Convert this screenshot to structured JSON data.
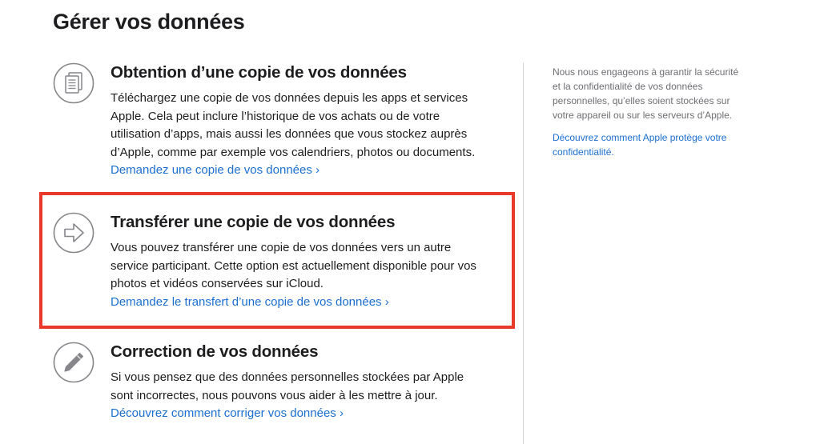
{
  "page": {
    "title": "Gérer vos données"
  },
  "sections": [
    {
      "title": "Obtention d’une copie de vos données",
      "body_lines": [
        "Téléchargez une copie de vos données depuis les apps et services",
        "Apple. Cela peut inclure l’historique de vos achats ou de votre",
        "utilisation d’apps, mais aussi les données que vous stockez auprès",
        "d’Apple, comme par exemple vos calendriers, photos ou documents."
      ],
      "link": "Demandez une copie de vos données ›",
      "icon": "documents-icon"
    },
    {
      "title": "Transférer une copie de vos données",
      "body_lines": [
        "Vous pouvez transférer une copie de vos données vers un autre",
        "service participant. Cette option est actuellement disponible pour vos",
        "photos et vidéos conservées sur iCloud."
      ],
      "link": "Demandez le transfert d’une copie de vos données ›",
      "icon": "arrow-right-icon"
    },
    {
      "title": "Correction de vos données",
      "body_lines": [
        "Si vous pensez que des données personnelles stockées par Apple",
        "sont incorrectes, nous pouvons vous aider à les mettre à jour."
      ],
      "link": "Découvrez comment corriger vos données ›",
      "icon": "pencil-icon"
    }
  ],
  "aside": {
    "text_lines": [
      "Nous nous engageons à garantir la sécurité",
      "et la confidentialité de vos données",
      "personnelles, qu’elles soient stockées sur",
      "votre appareil ou sur les serveurs d’Apple."
    ],
    "link_lines": [
      "Découvrez comment Apple protège votre",
      "confidentialité."
    ]
  },
  "colors": {
    "link": "#1b6fd1",
    "highlight": "#e8392a",
    "icon_stroke": "#86868b",
    "text": "#1d1d1f",
    "muted": "#6e6e73"
  }
}
